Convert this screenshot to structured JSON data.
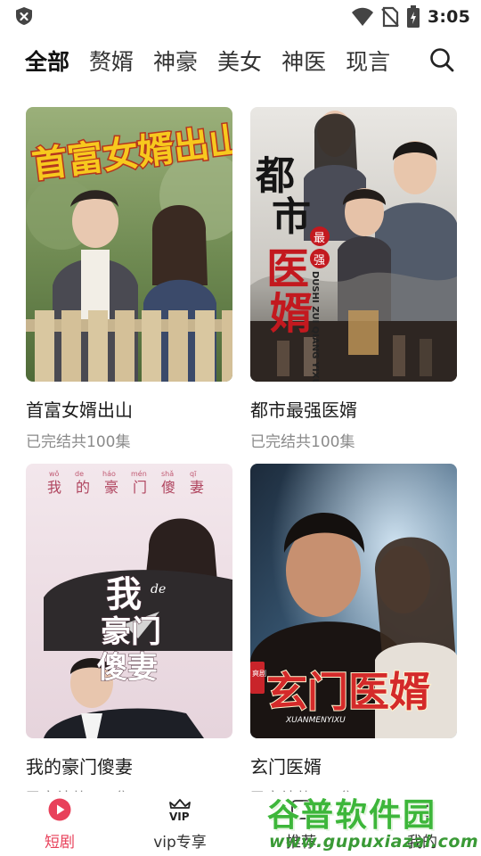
{
  "status_bar": {
    "time": "3:05"
  },
  "tabs": [
    {
      "label": "全部",
      "active": true
    },
    {
      "label": "赘婿",
      "active": false
    },
    {
      "label": "神豪",
      "active": false
    },
    {
      "label": "美女",
      "active": false
    },
    {
      "label": "神医",
      "active": false
    },
    {
      "label": "现言",
      "active": false
    }
  ],
  "dramas": [
    {
      "title": "首富女婿出山",
      "status": "已完结共100集",
      "poster_text": "首富女婿出山"
    },
    {
      "title": "都市最强医婿",
      "status": "已完结共100集",
      "poster_text": [
        "都",
        "市",
        "医",
        "婿"
      ],
      "poster_badge": [
        "最",
        "强"
      ],
      "poster_pinyin": "DUSHI ZUI QIANG YIXU"
    },
    {
      "title": "我的豪门傻妻",
      "status": "已完结共100集",
      "poster_text": [
        "我",
        "豪门",
        "傻妻"
      ],
      "poster_small": "de",
      "poster_top": [
        "我",
        "的",
        "豪",
        "门",
        "傻",
        "妻"
      ],
      "poster_top_pinyin": [
        "wǒ",
        "de",
        "háo",
        "mén",
        "shǎ",
        "qī"
      ]
    },
    {
      "title": "玄门医婿",
      "status": "已完结共100集",
      "poster_text": "玄门医婿",
      "poster_pinyin": "XUANMENYIXU",
      "poster_badge": "爽剧"
    }
  ],
  "bottom_nav": [
    {
      "label": "短剧",
      "icon": "play-icon",
      "active": true
    },
    {
      "label": "vip专享",
      "icon": "vip-crown-icon",
      "active": false
    },
    {
      "label": "推荐",
      "icon": "recommend-icon",
      "active": false
    },
    {
      "label": "我的",
      "icon": "profile-icon",
      "active": false
    }
  ],
  "vip_icon_text": "VIP",
  "watermark": {
    "name": "谷普软件园",
    "url": "www.gupuxiazai.com"
  },
  "colors": {
    "accent": "#e8405a",
    "watermark_green": "#3db63a"
  }
}
